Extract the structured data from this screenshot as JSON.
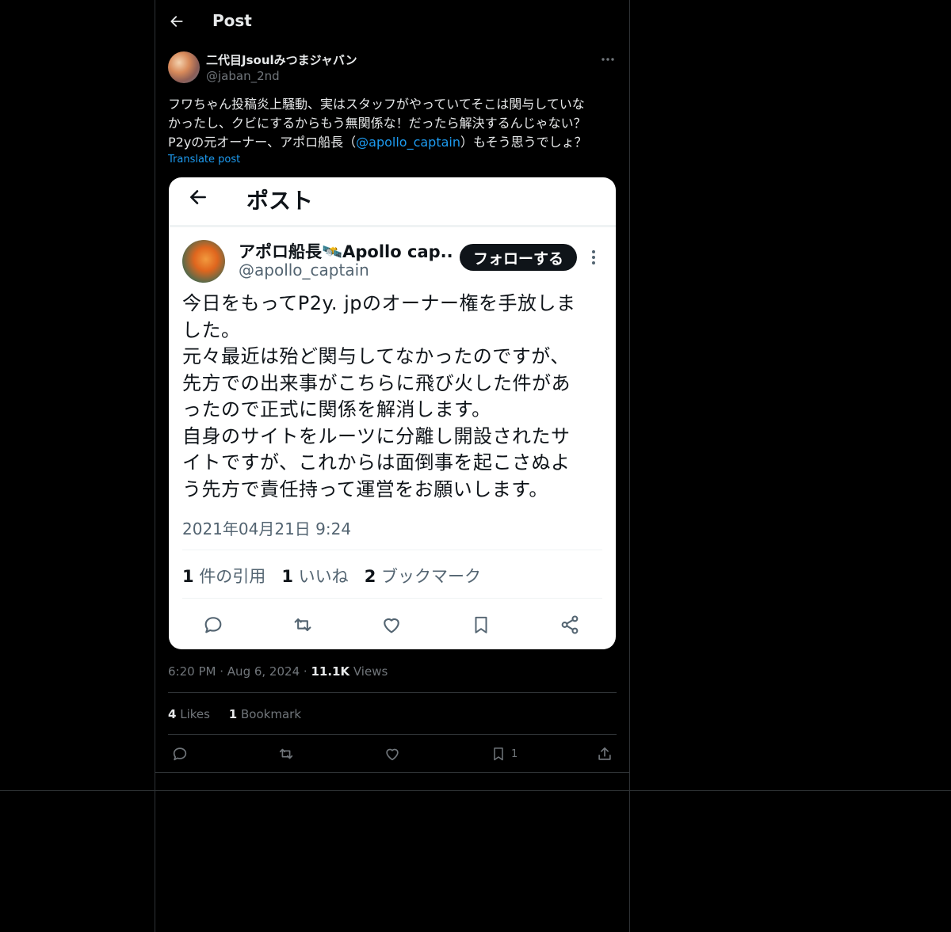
{
  "header": {
    "title": "Post"
  },
  "author": {
    "name": "二代目Jsoulみつまジャバン",
    "handle": "@jaban_2nd"
  },
  "post": {
    "line1": "フワちゃん投稿炎上騒動、実はスタッフがやっていてそこは関与していな",
    "line2": "かったし、クビにするからもう無関係な！だったら解決するんじゃない？",
    "line3_pre": "P2yの元オーナー、アポロ船長（",
    "mention": "@apollo_captain",
    "line3_post": "）もそう思うでしょ？",
    "translate": "Translate post"
  },
  "embedded": {
    "title": "ポスト",
    "name": "アポロ船長🛰️Apollo cap...",
    "handle": "@apollo_captain",
    "follow": "フォローする",
    "body": [
      "今日をもってP2y. jpのオーナー権を手放しま",
      "した。",
      "元々最近は殆ど関与してなかったのですが、",
      "先方での出来事がこちらに飛び火した件があ",
      "ったので正式に関係を解消します。",
      "自身のサイトをルーツに分離し開設されたサ",
      "イトですが、これからは面倒事を起こさぬよ",
      "う先方で責任持って運営をお願いします。"
    ],
    "timestamp": "2021年04月21日 9:24",
    "quotes_n": "1",
    "quotes_label": "件の引用",
    "likes_n": "1",
    "likes_label": "いいね",
    "bookmarks_n": "2",
    "bookmarks_label": "ブックマーク"
  },
  "meta": {
    "time": "6:20 PM",
    "dot1": "·",
    "date": "Aug 6, 2024",
    "dot2": "·",
    "views_n": "11.1K",
    "views_label": "Views"
  },
  "counts": {
    "likes_n": "4",
    "likes_label": "Likes",
    "bookmarks_n": "1",
    "bookmarks_label": "Bookmark"
  },
  "actions": {
    "bookmark_count": "1"
  },
  "colors": {
    "background": "#000000",
    "accent": "#1d9bf0",
    "muted": "#71767b",
    "border": "#2f3336"
  },
  "icons": [
    "arrow-left-icon",
    "more-icon",
    "reply-icon",
    "retweet-icon",
    "heart-icon",
    "bookmark-icon",
    "share-icon"
  ]
}
